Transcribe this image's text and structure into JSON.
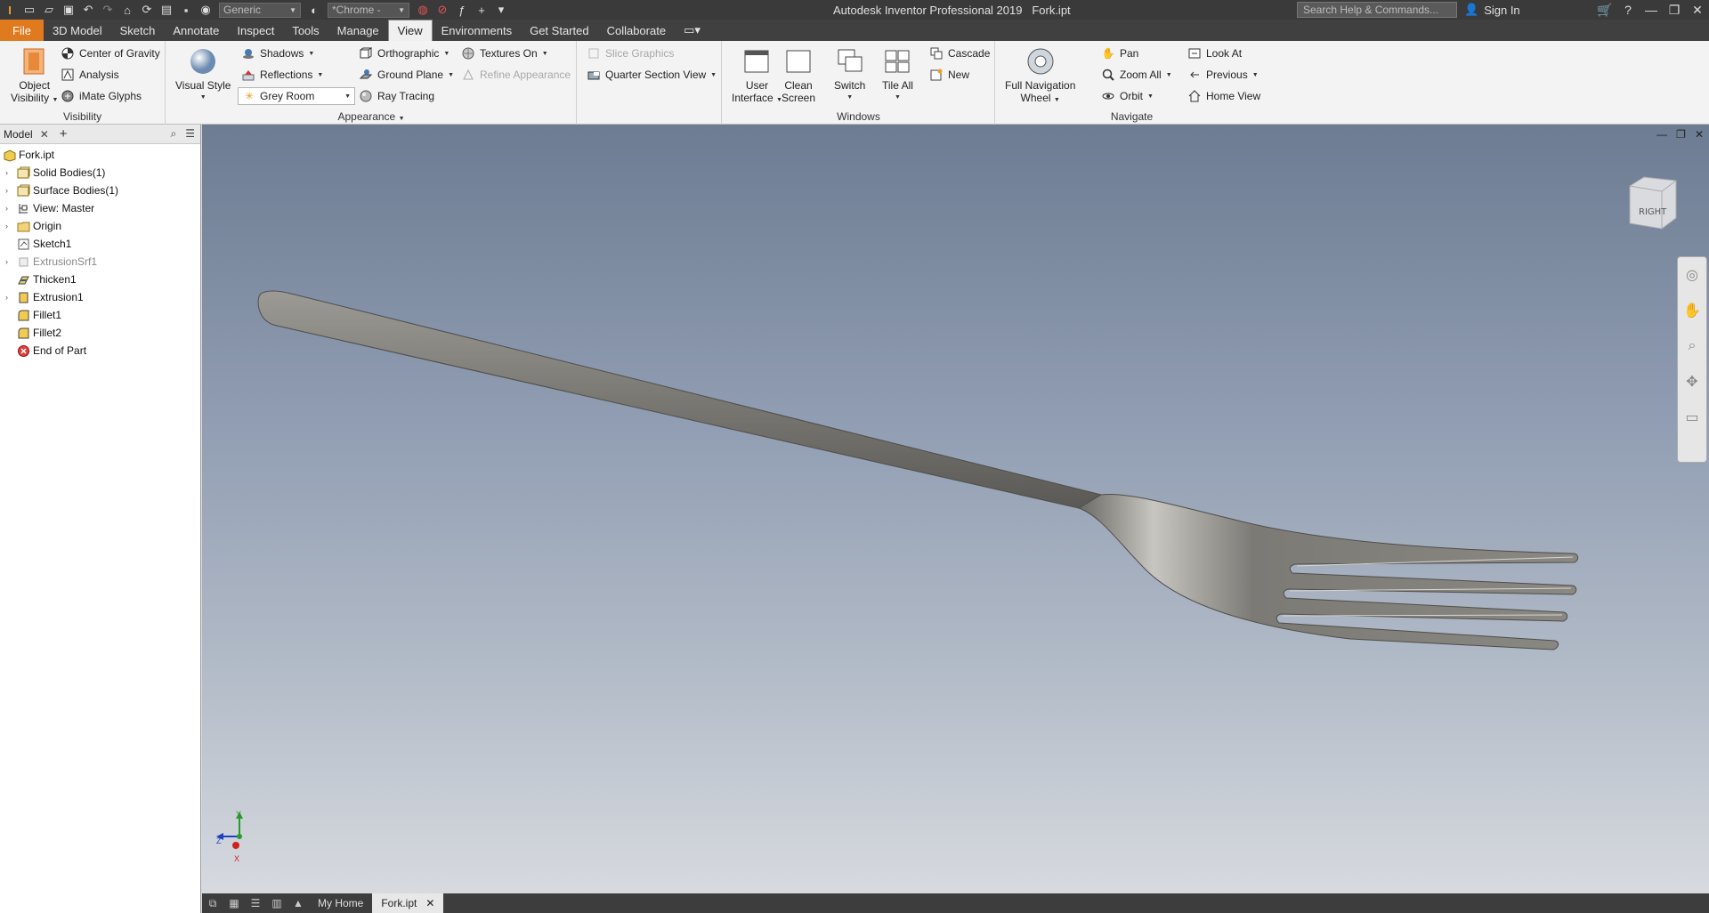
{
  "titlebar": {
    "app_title": "Autodesk Inventor Professional 2019",
    "document": "Fork.ipt",
    "material_combo": "Generic",
    "appearance_combo": "*Chrome -",
    "search_placeholder": "Search Help & Commands...",
    "sign_in": "Sign In"
  },
  "tabs": [
    {
      "label": "File"
    },
    {
      "label": "3D Model"
    },
    {
      "label": "Sketch"
    },
    {
      "label": "Annotate"
    },
    {
      "label": "Inspect"
    },
    {
      "label": "Tools"
    },
    {
      "label": "Manage"
    },
    {
      "label": "View"
    },
    {
      "label": "Environments"
    },
    {
      "label": "Get Started"
    },
    {
      "label": "Collaborate"
    }
  ],
  "ribbon": {
    "visibility": {
      "title": "Visibility",
      "object_visibility_1": "Object",
      "object_visibility_2": "Visibility",
      "center_of_gravity": "Center of Gravity",
      "analysis": "Analysis",
      "imate_glyphs": "iMate Glyphs"
    },
    "appearance": {
      "title": "Appearance",
      "visual_style": "Visual Style",
      "shadows": "Shadows",
      "reflections": "Reflections",
      "lighting": "Grey Room",
      "orthographic": "Orthographic",
      "ground_plane": "Ground Plane",
      "ray_tracing": "Ray Tracing",
      "textures_on": "Textures On",
      "refine_appearance": "Refine Appearance"
    },
    "section": {
      "slice_graphics": "Slice Graphics",
      "quarter_section": "Quarter Section View"
    },
    "windows": {
      "title": "Windows",
      "user_interface_1": "User",
      "user_interface_2": "Interface",
      "clean_screen_1": "Clean",
      "clean_screen_2": "Screen",
      "switch": "Switch",
      "tile_all": "Tile All",
      "cascade": "Cascade",
      "new": "New"
    },
    "navigate": {
      "title": "Navigate",
      "full_nav_1": "Full Navigation",
      "full_nav_2": "Wheel",
      "pan": "Pan",
      "zoom_all": "Zoom All",
      "orbit": "Orbit",
      "look_at": "Look At",
      "previous": "Previous",
      "home_view": "Home View"
    }
  },
  "browser": {
    "tab": "Model",
    "tree": [
      {
        "label": "Fork.ipt"
      },
      {
        "label": "Solid Bodies(1)"
      },
      {
        "label": "Surface Bodies(1)"
      },
      {
        "label": "View: Master"
      },
      {
        "label": "Origin"
      },
      {
        "label": "Sketch1"
      },
      {
        "label": "ExtrusionSrf1"
      },
      {
        "label": "Thicken1"
      },
      {
        "label": "Extrusion1"
      },
      {
        "label": "Fillet1"
      },
      {
        "label": "Fillet2"
      },
      {
        "label": "End of Part"
      }
    ]
  },
  "viewport": {
    "viewcube_face": "RIGHT",
    "axis_y": "Y",
    "axis_z": "Z",
    "axis_x": "X"
  },
  "doc_tabs": {
    "home": "My Home",
    "active": "Fork.ipt"
  },
  "colors": {
    "file_tab": "#e07a1e",
    "titlebar": "#3a3a3a",
    "ribbon": "#f3f3f3"
  }
}
